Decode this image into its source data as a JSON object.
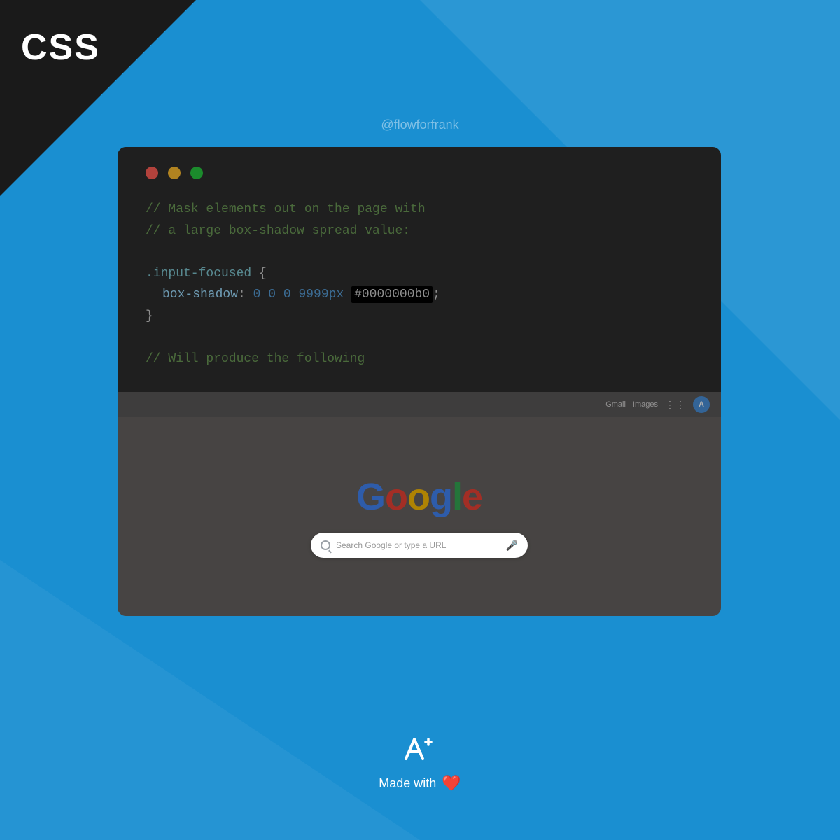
{
  "background": {
    "main_color": "#1a8fd1",
    "dark_triangle_color": "#1a1a1a"
  },
  "css_label": "CSS",
  "handle": "@flowforfrank",
  "traffic_lights": {
    "red": "#ff5f57",
    "yellow": "#febc2e",
    "green": "#28c840"
  },
  "code": {
    "comment1": "// Mask elements out on the page with",
    "comment2": "// a large box-shadow spread value:",
    "selector": ".input-focused",
    "open_brace": "{",
    "property": "box-shadow",
    "colon": ":",
    "value_nums": "0 0 0 9999px",
    "value_highlight": "#0000000b0",
    "semicolon": ";",
    "close_brace": "}",
    "comment3": "// Will produce the following"
  },
  "browser": {
    "topbar_items": [
      "Gmail",
      "Images"
    ],
    "avatar_letter": "A",
    "google_logo": "Google",
    "search_placeholder": "Search Google or type a URL"
  },
  "footer": {
    "made_with_text": "Made with",
    "logo_alt": "A+"
  }
}
